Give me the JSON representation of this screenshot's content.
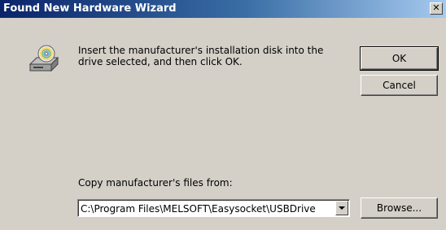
{
  "window": {
    "title": "Found New Hardware Wizard",
    "close_glyph": "✕"
  },
  "message": "Insert the manufacturer's installation disk into the drive selected, and then click OK.",
  "buttons": {
    "ok": "OK",
    "cancel": "Cancel",
    "browse": "Browse..."
  },
  "copy_from": {
    "label": "Copy manufacturer's files from:",
    "value": "C:\\Program Files\\MELSOFT\\Easysocket\\USBDrive"
  },
  "icons": {
    "disk": "disk-drive-icon",
    "close": "close-icon",
    "dropdown": "chevron-down-icon"
  },
  "colors": {
    "face": "#d4d0c8",
    "title_start": "#0a246a",
    "title_end": "#a6caf0"
  }
}
